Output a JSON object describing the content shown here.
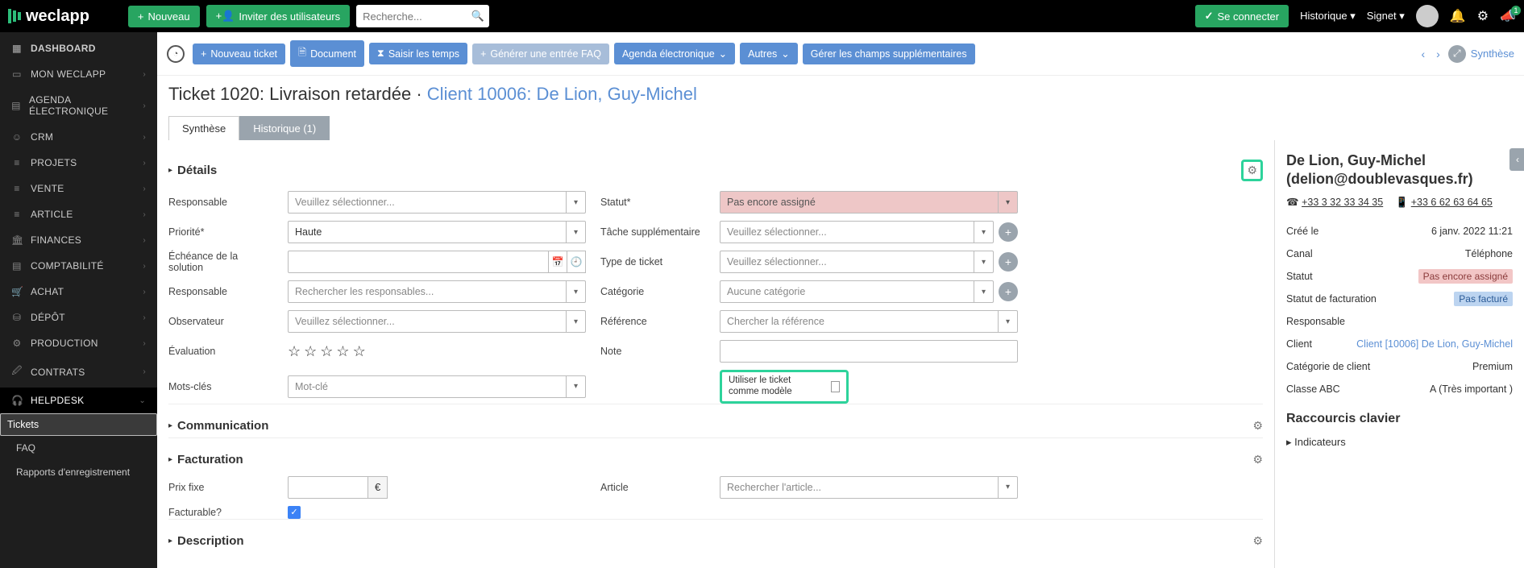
{
  "topbar": {
    "brand": "weclapp",
    "new_btn": "Nouveau",
    "invite_btn": "Inviter des utilisateurs",
    "search_placeholder": "Recherche...",
    "connect_btn": "Se connecter",
    "history": "Historique",
    "signet": "Signet",
    "horn_badge": "1"
  },
  "sidebar": {
    "items": [
      {
        "icon": "▦",
        "label": "DASHBOARD",
        "chev": false
      },
      {
        "icon": "▭",
        "label": "MON WECLAPP",
        "chev": true
      },
      {
        "icon": "▤",
        "label": "AGENDA ÉLECTRONIQUE",
        "chev": true
      },
      {
        "icon": "☺",
        "label": "CRM",
        "chev": true
      },
      {
        "icon": "≡",
        "label": "PROJETS",
        "chev": true
      },
      {
        "icon": "≡",
        "label": "VENTE",
        "chev": true
      },
      {
        "icon": "≡",
        "label": "ARTICLE",
        "chev": true
      },
      {
        "icon": "🏛",
        "label": "FINANCES",
        "chev": true
      },
      {
        "icon": "▤",
        "label": "COMPTABILITÉ",
        "chev": true
      },
      {
        "icon": "🛒",
        "label": "ACHAT",
        "chev": true
      },
      {
        "icon": "⛁",
        "label": "DÉPÔT",
        "chev": true
      },
      {
        "icon": "⚙",
        "label": "PRODUCTION",
        "chev": true
      },
      {
        "icon": "🖉",
        "label": "CONTRATS",
        "chev": true
      },
      {
        "icon": "🎧",
        "label": "HELPDESK",
        "chev": true,
        "open": true
      }
    ],
    "subs": [
      "Tickets",
      "FAQ",
      "Rapports d'enregistrement"
    ]
  },
  "toolbar": {
    "new_ticket": "Nouveau ticket",
    "document": "Document",
    "time": "Saisir les temps",
    "faq": "Générer une entrée FAQ",
    "agenda": "Agenda électronique",
    "autres": "Autres",
    "fields": "Gérer les champs supplémentaires",
    "synth": "Synthèse"
  },
  "title": {
    "ticket": "Ticket 1020: Livraison retardée",
    "sep": " · ",
    "client": "Client 10006: De Lion, Guy-Michel"
  },
  "tabs": {
    "synth": "Synthèse",
    "hist": "Historique (1)"
  },
  "sections": {
    "details": "Détails",
    "comm": "Communication",
    "fact": "Facturation",
    "desc": "Description"
  },
  "labels": {
    "responsable": "Responsable",
    "priorite": "Priorité*",
    "echeance": "Échéance de la solution",
    "responsable2": "Responsable",
    "observateur": "Observateur",
    "evaluation": "Évaluation",
    "motscles": "Mots-clés",
    "statut": "Statut*",
    "tache": "Tâche supplémentaire",
    "type": "Type de ticket",
    "categorie": "Catégorie",
    "reference": "Référence",
    "note": "Note",
    "template": "Utiliser le ticket comme modèle",
    "prixfixe": "Prix fixe",
    "facturable": "Facturable?",
    "article": "Article",
    "currency": "€"
  },
  "placeholders": {
    "select": "Veuillez sélectionner...",
    "haute": "Haute",
    "rechresp": "Rechercher les responsables...",
    "motcle": "Mot-clé",
    "pasassigne": "Pas encore assigné",
    "aucunecat": "Aucune catégorie",
    "chercherref": "Chercher la référence",
    "rechart": "Rechercher l'article..."
  },
  "right": {
    "name": "De Lion, Guy-Michel (delion@doublevasques.fr)",
    "phone1": "+33 3 32 33 34 35",
    "phone2": "+33 6 62 63 64 65",
    "rows": {
      "cree": "Créé le",
      "cree_v": "6 janv. 2022 11:21",
      "canal": "Canal",
      "canal_v": "Téléphone",
      "statut": "Statut",
      "statut_v": "Pas encore assigné",
      "sfact": "Statut de facturation",
      "sfact_v": "Pas facturé",
      "resp": "Responsable",
      "resp_v": "",
      "client": "Client",
      "client_v": "Client [10006] De Lion, Guy-Michel",
      "catcli": "Catégorie de client",
      "catcli_v": "Premium",
      "abc": "Classe ABC",
      "abc_v": "A (Très important )"
    },
    "shortcuts": "Raccourcis clavier",
    "indic": "Indicateurs"
  }
}
